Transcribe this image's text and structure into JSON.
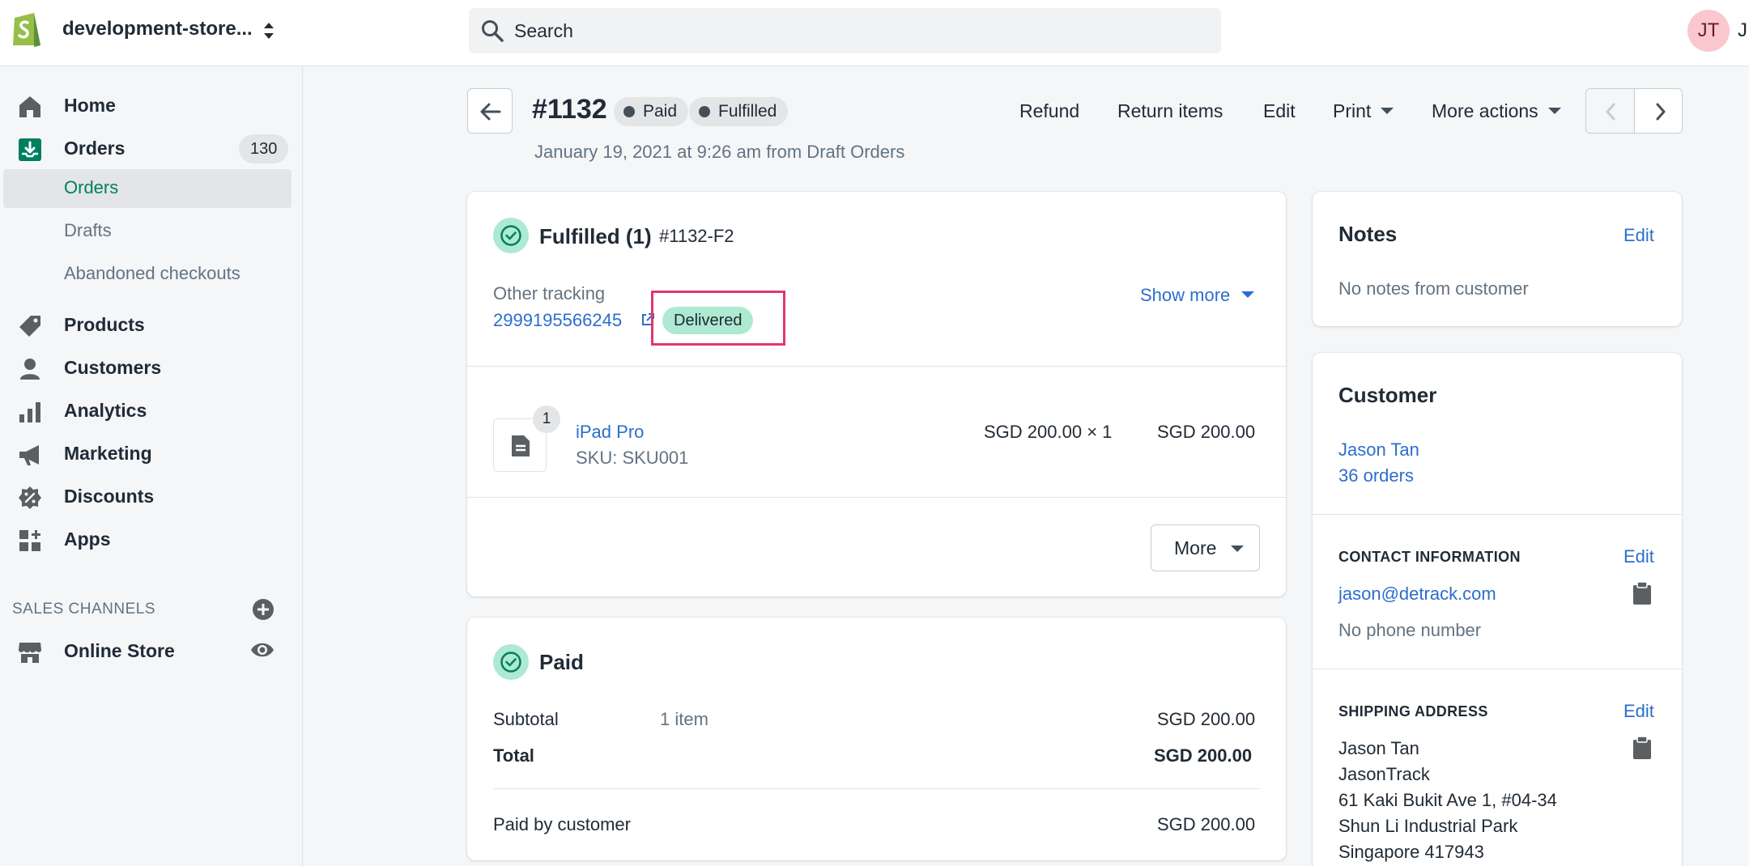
{
  "topbar": {
    "store_name": "development-store...",
    "search_placeholder": "Search",
    "avatar_initials": "JT",
    "user_name_partial": "J",
    "colors": {
      "avatar_bg": "#fbc7cf",
      "brand_green": "#95bf47"
    }
  },
  "sidebar": {
    "items": [
      {
        "label": "Home",
        "icon": "home-icon"
      },
      {
        "label": "Orders",
        "icon": "orders-icon",
        "badge": "130"
      },
      {
        "label": "Products",
        "icon": "tag-icon"
      },
      {
        "label": "Customers",
        "icon": "person-icon"
      },
      {
        "label": "Analytics",
        "icon": "bar-chart-icon"
      },
      {
        "label": "Marketing",
        "icon": "megaphone-icon"
      },
      {
        "label": "Discounts",
        "icon": "discount-icon"
      },
      {
        "label": "Apps",
        "icon": "apps-icon"
      }
    ],
    "orders_subitems": [
      {
        "label": "Orders",
        "active": true
      },
      {
        "label": "Drafts"
      },
      {
        "label": "Abandoned checkouts"
      }
    ],
    "sales_channels_heading": "SALES CHANNELS",
    "online_store_label": "Online Store"
  },
  "header": {
    "order_number": "#1132",
    "status_paid": "Paid",
    "status_fulfilled": "Fulfilled",
    "subtitle": "January 19, 2021 at 9:26 am from Draft Orders",
    "actions": {
      "refund": "Refund",
      "return_items": "Return items",
      "edit": "Edit",
      "print": "Print",
      "more_actions": "More actions"
    }
  },
  "fulfilled_card": {
    "title": "Fulfilled (1)",
    "fulfillment_id": "#1132-F2",
    "tracking_label": "Other tracking",
    "tracking_number": "2999195566245",
    "delivery_status": "Delivered",
    "show_more": "Show more",
    "line_item": {
      "name": "iPad Pro",
      "sku": "SKU: SKU001",
      "quantity": "1",
      "unit_price": "SGD 200.00 × 1",
      "total": "SGD 200.00"
    },
    "more_button": "More"
  },
  "paid_card": {
    "title": "Paid",
    "subtotal_label": "Subtotal",
    "subtotal_items": "1 item",
    "subtotal_value": "SGD 200.00",
    "total_label": "Total",
    "total_value": "SGD 200.00",
    "paid_by_label": "Paid by customer",
    "paid_by_value": "SGD 200.00"
  },
  "notes_card": {
    "title": "Notes",
    "edit": "Edit",
    "body": "No notes from customer"
  },
  "customer_card": {
    "title": "Customer",
    "name": "Jason Tan",
    "orders": "36 orders",
    "contact_heading": "CONTACT INFORMATION",
    "contact_edit": "Edit",
    "email": "jason@detrack.com",
    "phone": "No phone number",
    "shipping_heading": "SHIPPING ADDRESS",
    "shipping_edit": "Edit",
    "address": [
      "Jason Tan",
      "JasonTrack",
      "61 Kaki Bukit Ave 1, #04-34",
      "Shun Li Industrial Park",
      "Singapore 417943"
    ]
  }
}
